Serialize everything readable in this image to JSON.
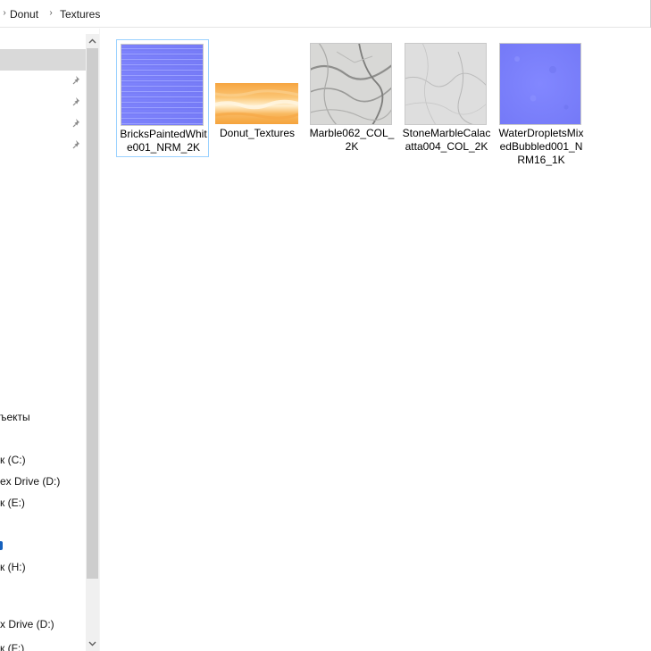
{
  "breadcrumb": {
    "items": [
      "Donut",
      "Textures"
    ]
  },
  "nav": {
    "pinned_items": [
      "",
      "",
      "",
      ""
    ],
    "items": [
      {
        "label": "ъекты"
      },
      {
        "label": "к (C:)"
      },
      {
        "label": "ex Drive (D:)"
      },
      {
        "label": "к (E:)"
      },
      {
        "label": "к (H:)"
      },
      {
        "label": "x Drive (D:)"
      },
      {
        "label": "к (F:)"
      }
    ]
  },
  "files": [
    {
      "name": "BricksPaintedWhite001_NRM_2K",
      "icon": "normal-map-thumbnail",
      "selected": true
    },
    {
      "name": "Donut_Textures",
      "icon": "donut-texture-thumbnail",
      "selected": false
    },
    {
      "name": "Marble062_COL_2K",
      "icon": "marble-thumbnail",
      "selected": false
    },
    {
      "name": "StoneMarbleCalacatta004_COL_2K",
      "icon": "stone-marble-thumbnail",
      "selected": false
    },
    {
      "name": "WaterDropletsMixedBubbled001_NRM16_1K",
      "icon": "water-normal-thumbnail",
      "selected": false
    }
  ],
  "icons": {
    "breadcrumb_separator": "chevron-right-icon",
    "pin": "pin-icon",
    "scroll_up": "scroll-up-arrow-icon",
    "scroll_down": "scroll-down-arrow-icon"
  },
  "colors": {
    "selection_border": "#99d1ff",
    "nav_selected": "#d9d9d9",
    "normal_map": "#7b80ff",
    "donut_texture": "#f7b65c"
  }
}
